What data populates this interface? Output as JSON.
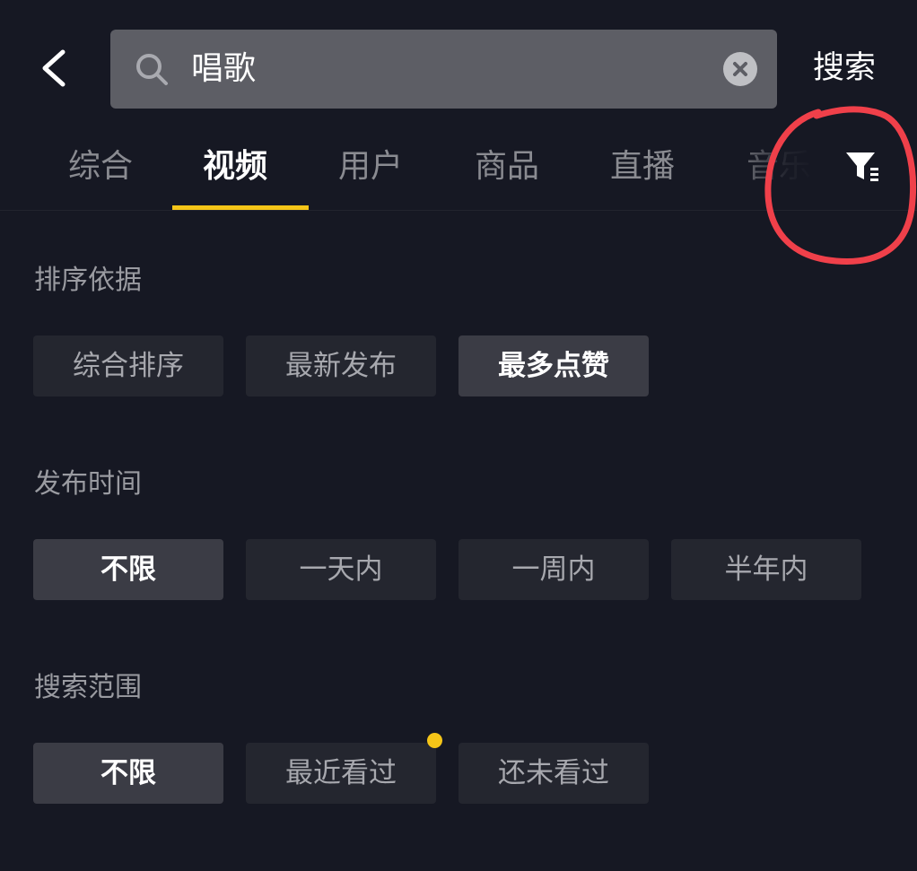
{
  "header": {
    "search_query": "唱歌",
    "search_button_label": "搜索",
    "back_icon": "chevron-left-icon",
    "search_icon": "magnifier-icon",
    "clear_icon": "clear-x-icon"
  },
  "tabs": [
    {
      "label": "综合",
      "active": false
    },
    {
      "label": "视频",
      "active": true
    },
    {
      "label": "用户",
      "active": false
    },
    {
      "label": "商品",
      "active": false
    },
    {
      "label": "直播",
      "active": false
    },
    {
      "label": "音乐",
      "active": false
    }
  ],
  "filter_icon": "filter-funnel-icon",
  "sections": [
    {
      "title": "排序依据",
      "options": [
        "综合排序",
        "最新发布",
        "最多点赞"
      ],
      "selected": "最多点赞"
    },
    {
      "title": "发布时间",
      "options": [
        "不限",
        "一天内",
        "一周内",
        "半年内"
      ],
      "selected": "不限"
    },
    {
      "title": "搜索范围",
      "options": [
        "不限",
        "最近看过",
        "还未看过"
      ],
      "selected": "不限"
    }
  ],
  "colors": {
    "background": "#161823",
    "accent": "#f5c518",
    "annotation": "#f0404a",
    "chip": "#24262f",
    "chip_selected": "#3b3c45"
  }
}
